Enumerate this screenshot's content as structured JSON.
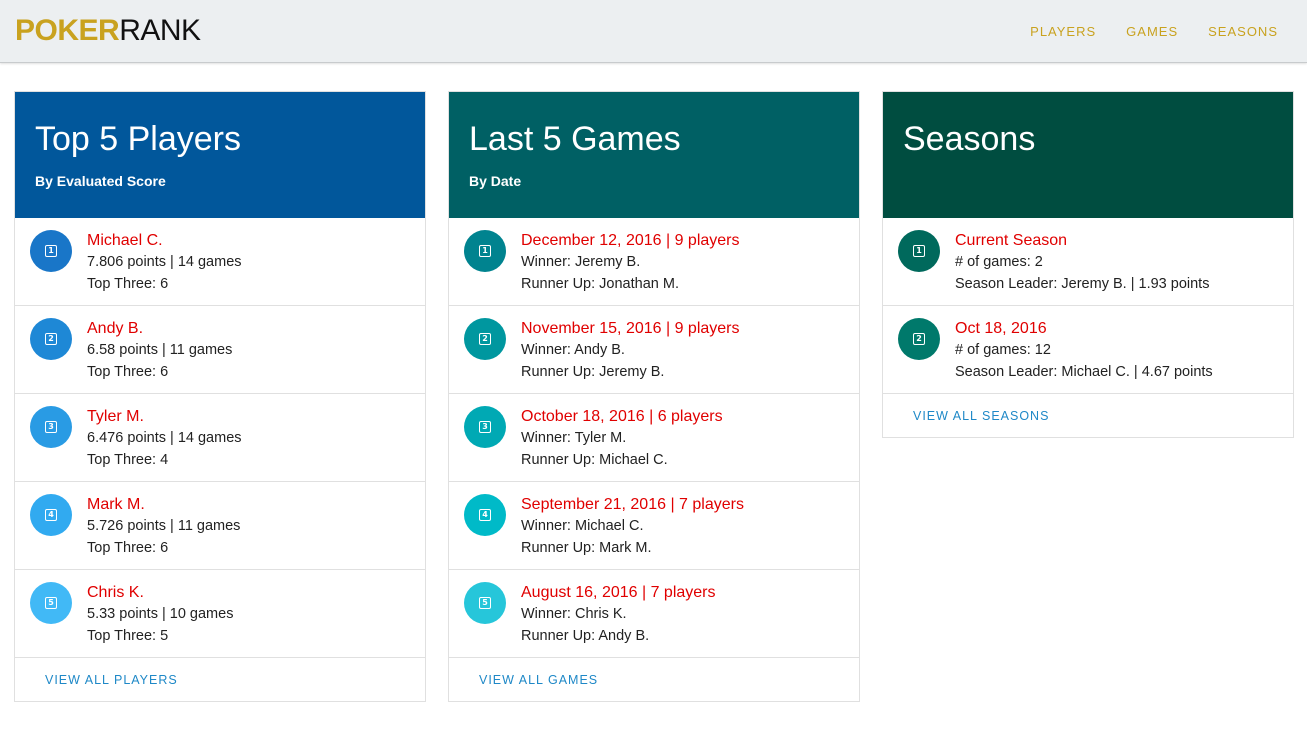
{
  "brand": {
    "part1": "POKER",
    "part2": "RANK"
  },
  "nav": [
    {
      "label": "PLAYERS"
    },
    {
      "label": "GAMES"
    },
    {
      "label": "SEASONS"
    }
  ],
  "players_card": {
    "title": "Top 5 Players",
    "subtitle": "By Evaluated Score",
    "items": [
      {
        "rank": "1",
        "name": "Michael C.",
        "line1": "7.806 points | 14 games",
        "line2": "Top Three: 6",
        "badge_color": "#1976c8"
      },
      {
        "rank": "2",
        "name": "Andy B.",
        "line1": "6.58 points | 11 games",
        "line2": "Top Three: 6",
        "badge_color": "#1e88d6"
      },
      {
        "rank": "3",
        "name": "Tyler M.",
        "line1": "6.476 points | 14 games",
        "line2": "Top Three: 4",
        "badge_color": "#299be4"
      },
      {
        "rank": "4",
        "name": "Mark M.",
        "line1": "5.726 points | 11 games",
        "line2": "Top Three: 6",
        "badge_color": "#31aaf0"
      },
      {
        "rank": "5",
        "name": "Chris K.",
        "line1": "5.33 points | 10 games",
        "line2": "Top Three: 5",
        "badge_color": "#41b9f6"
      }
    ],
    "footer": "VIEW ALL PLAYERS"
  },
  "games_card": {
    "title": "Last 5 Games",
    "subtitle": "By Date",
    "items": [
      {
        "rank": "1",
        "title": "December 12, 2016 | 9 players",
        "line1": "Winner: Jeremy B.",
        "line2": "Runner Up: Jonathan M.",
        "badge_color": "#00838f"
      },
      {
        "rank": "2",
        "title": "November 15, 2016 | 9 players",
        "line1": "Winner: Andy B.",
        "line2": "Runner Up: Jeremy B.",
        "badge_color": "#00979f"
      },
      {
        "rank": "3",
        "title": "October 18, 2016 | 6 players",
        "line1": "Winner: Tyler M.",
        "line2": "Runner Up: Michael C.",
        "badge_color": "#00a9b4"
      },
      {
        "rank": "4",
        "title": "September 21, 2016 | 7 players",
        "line1": "Winner: Michael C.",
        "line2": "Runner Up: Mark M.",
        "badge_color": "#00bac8"
      },
      {
        "rank": "5",
        "title": "August 16, 2016 | 7 players",
        "line1": "Winner: Chris K.",
        "line2": "Runner Up: Andy B.",
        "badge_color": "#26c6da"
      }
    ],
    "footer": "VIEW ALL GAMES"
  },
  "seasons_card": {
    "title": "Seasons",
    "subtitle": "",
    "items": [
      {
        "rank": "1",
        "title": "Current Season",
        "line1": "# of games: 2",
        "line2": "Season Leader: Jeremy B. | 1.93 points",
        "badge_color": "#00695c"
      },
      {
        "rank": "2",
        "title": "Oct 18, 2016",
        "line1": "# of games: 12",
        "line2": "Season Leader: Michael C. | 4.67 points",
        "badge_color": "#00796b"
      }
    ],
    "footer": "VIEW ALL SEASONS"
  },
  "colors": {
    "brand_gold": "#c9a21f",
    "players_header": "#01579b",
    "games_header": "#006064",
    "seasons_header": "#004d40",
    "link_red": "#e00000",
    "footer_link_blue": "#1e88c7"
  }
}
